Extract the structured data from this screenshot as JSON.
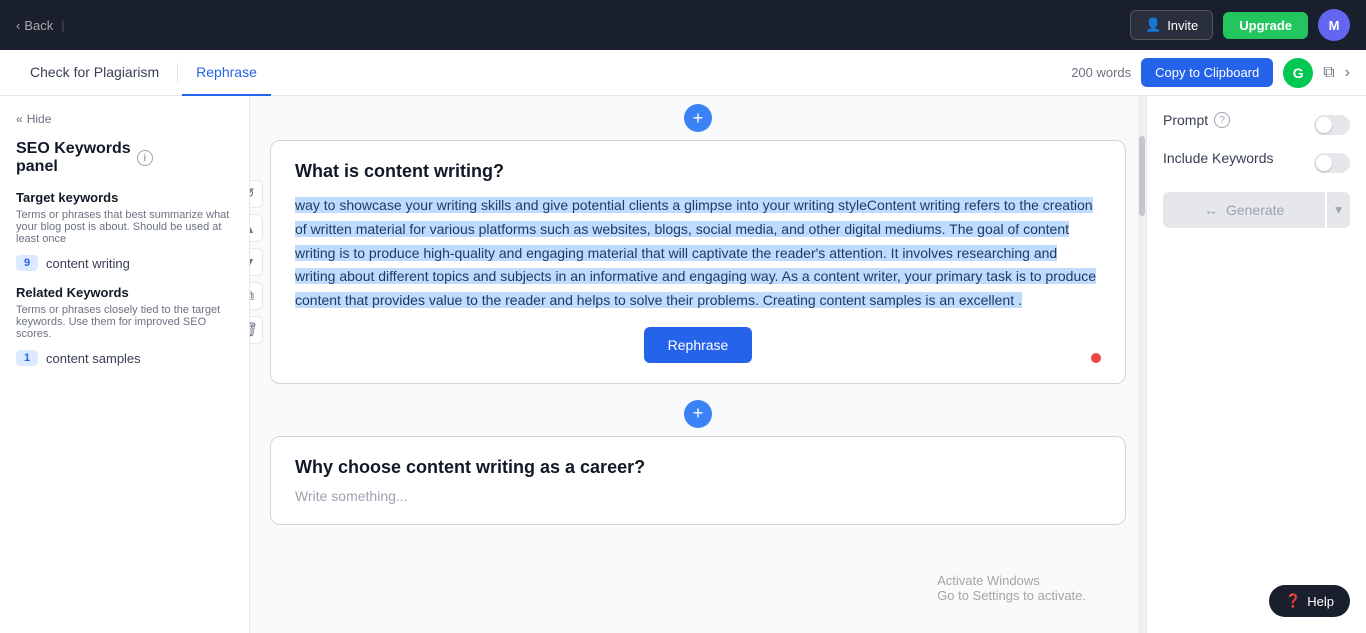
{
  "topNav": {
    "backLabel": "Back",
    "inviteLabel": "Invite",
    "upgradeLabel": "Upgrade",
    "avatarInitial": "M"
  },
  "subNav": {
    "tabs": [
      {
        "id": "plagiarism",
        "label": "Check for Plagiarism",
        "active": false
      },
      {
        "id": "rephrase",
        "label": "Rephrase",
        "active": true
      }
    ],
    "wordCount": "200 words",
    "copyLabel": "Copy to Clipboard"
  },
  "sidebar": {
    "hideLabel": "Hide",
    "title": "SEO Keywords\npanel",
    "targetKeywordsTitle": "Target keywords",
    "targetKeywordsDesc": "Terms or phrases that best summarize what your blog post is about. Should be used at least once",
    "targetKeywords": [
      {
        "count": 9,
        "text": "content writing"
      }
    ],
    "relatedKeywordsTitle": "Related Keywords",
    "relatedKeywordsDesc": "Terms or phrases closely tied to the target keywords. Use them for improved SEO scores.",
    "relatedKeywords": [
      {
        "count": 1,
        "text": "content samples"
      }
    ]
  },
  "editor": {
    "block1": {
      "title": "What is content writing?",
      "selectedText": "way to showcase your writing skills and give potential clients a glimpse into your writing styleContent writing refers to the creation of written material for various platforms such as websites, blogs, social media, and other digital mediums. The goal of content writing is to produce high-quality and engaging material that will captivate the reader's attention. It involves researching and writing about different topics and subjects in an informative and engaging way. As a content writer, your primary task is to produce content that provides value to the reader and helps to solve their problems. Creating content samples is an excellent ."
    },
    "rephraseBtn": "Rephrase",
    "block2": {
      "title": "Why choose content writing as a career?",
      "placeholder": "Write something..."
    },
    "addBlockLabel": "+"
  },
  "rightPanel": {
    "promptLabel": "Prompt",
    "includeKeywordsLabel": "Include Keywords",
    "generateLabel": "Generate"
  },
  "activateWindows": {
    "line1": "Activate Windows",
    "line2": "Go to Settings to activate."
  },
  "helpBtn": "Help"
}
